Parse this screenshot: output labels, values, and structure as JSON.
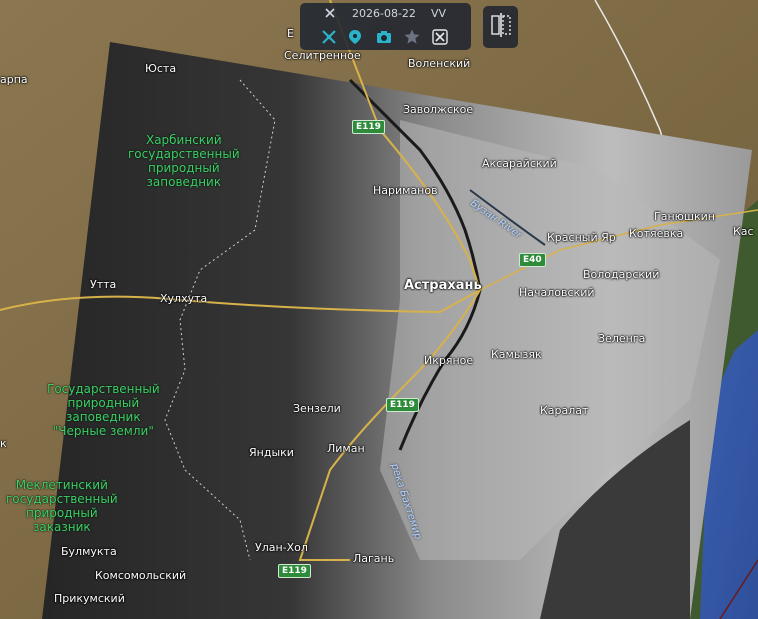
{
  "toolbar": {
    "date": "2026-08-22",
    "polarization": "VV",
    "icons": [
      "tools-icon",
      "satellite-icon",
      "location-pin-icon",
      "camera-icon",
      "star-icon",
      "scissors-icon"
    ]
  },
  "compare_icon": "compare-split-icon",
  "colors": {
    "accent": "#2bb3c9",
    "road_shield": "#2e8b3a",
    "protected_area_text": "#3fcf6a"
  },
  "labels": {
    "e_top": "Е",
    "selitrennoe": "Селитренное",
    "volenskiy": "Воленский",
    "yusta": "Юста",
    "zavolzhskoe": "Заволжское",
    "arpa": "арпа",
    "aksarayskiy": "Аксарайский",
    "narimanov": "Нариманов",
    "ganyushkin": "Ганюшкин",
    "kas": "Кас",
    "krasny_yar": "Красный Яр",
    "kotyaevka": "Котяевка",
    "volodarskiy": "Володарский",
    "astrakhan": "Астрахань",
    "nachalovskiy": "Началовский",
    "utta": "Утта",
    "khulkhuta": "Хулхута",
    "zelenga": "Зеленга",
    "ikryanoe": "Икряное",
    "kamyzyak": "Камызяк",
    "zenzeli": "Зензели",
    "karalat": "Каралат",
    "yandyki": "Яндыки",
    "liman": "Лиман",
    "ulan_khol": "Улан-Хол",
    "lagan": "Лагань",
    "bulmukta": "Булмукта",
    "komsomolskiy": "Комсомольский",
    "prikumskiy": "Прикумский",
    "reserve_kharbinsky": "Харбинский\nгосударственный\nприродный\nзаповедник",
    "reserve_black_lands": "Государственный\nприродный\nзаповедник\n\"Черные земли\"",
    "reserve_mekletinsky": "Меклетинский\nгосударственный\nприродный\nзаказник",
    "k_edge": "к",
    "buzan_river": "Бузан River",
    "bakhtemir_river": "река Бахтемир"
  },
  "roads": {
    "e119_north": "E119",
    "e40": "E40",
    "e119_mid": "E119",
    "e119_south": "E119"
  }
}
